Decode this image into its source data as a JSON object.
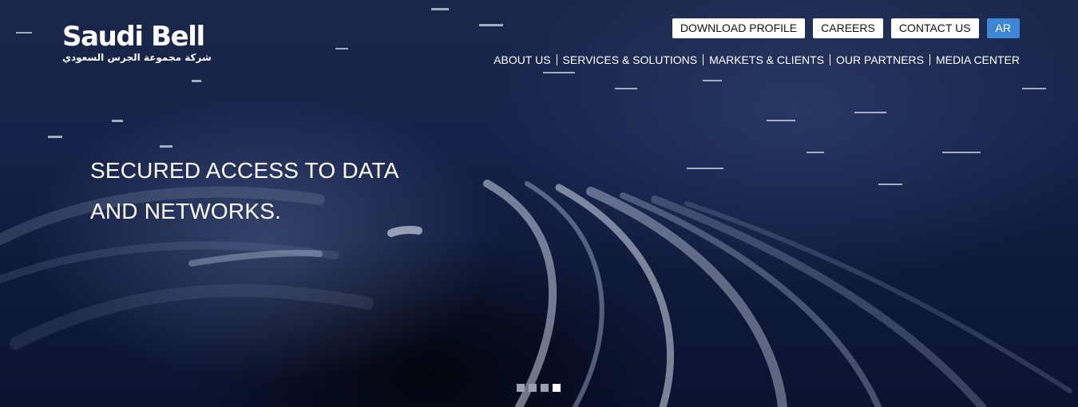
{
  "brand": {
    "name": "Saudi Bell",
    "arabic_name": "شركة مجموعة الجرس السعودي"
  },
  "top_buttons": {
    "download_profile": "DOWNLOAD PROFILE",
    "careers": "CAREERS",
    "contact_us": "CONTACT US",
    "language": "AR"
  },
  "main_nav": {
    "items": [
      {
        "label": "ABOUT US"
      },
      {
        "label": "SERVICES & SOLUTIONS"
      },
      {
        "label": "MARKETS & CLIENTS"
      },
      {
        "label": "OUR PARTNERS"
      },
      {
        "label": "MEDIA CENTER"
      }
    ]
  },
  "hero": {
    "headline_line1": "SECURED ACCESS TO DATA",
    "headline_line2": "AND NETWORKS."
  },
  "slider": {
    "slide_count": 4,
    "active_slide": 4
  },
  "colors": {
    "background": "#17224a",
    "button_bg": "#ffffff",
    "language_button_bg": "#3d86d4",
    "text": "#ffffff"
  }
}
